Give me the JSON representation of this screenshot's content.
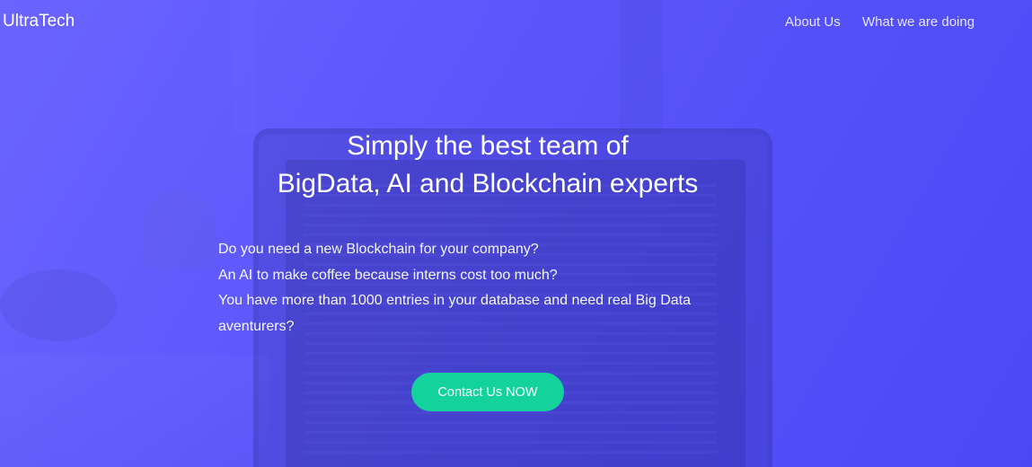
{
  "navbar": {
    "brand": "UltraTech",
    "links": [
      {
        "label": "About Us"
      },
      {
        "label": "What we are doing"
      }
    ]
  },
  "hero": {
    "headline_line1": "Simply the best team of",
    "headline_line2": "BigData, AI and Blockchain experts",
    "intro_lines": [
      "Do you need a new Blockchain for your company?",
      "An AI to make coffee because interns cost too much?",
      "You have more than 1000 entries in your database and need real Big Data aventurers?"
    ],
    "cta_label": "Contact Us NOW"
  },
  "colors": {
    "background_gradient_start": "#6b64ff",
    "background_gradient_end": "#4b49f6",
    "cta_background": "#14d29c",
    "text": "#ffffff"
  }
}
